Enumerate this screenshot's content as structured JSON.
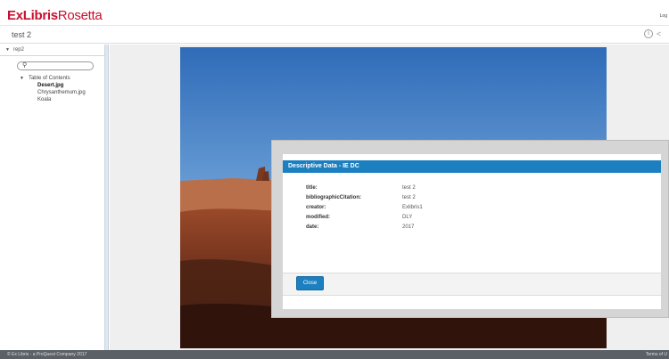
{
  "header": {
    "logo_ex": "ExLibris",
    "logo_rosetta": "Rosetta",
    "login_label": "Log"
  },
  "titlebar": {
    "title": "test 2",
    "info_icon": "info-icon",
    "share_icon": "share-icon"
  },
  "sidebar": {
    "rep_label": "rep2",
    "search": {
      "value": "",
      "placeholder": ""
    },
    "toc": {
      "heading": "Table of Contents",
      "items": [
        "Desert.jpg",
        "Chrysanthemum.jpg",
        "Koala"
      ],
      "active_index": 0
    }
  },
  "modal": {
    "title": "Descriptive Data - IE DC",
    "rows": [
      {
        "key": "title:",
        "value": "test 2"
      },
      {
        "key": "bibliographicCitation:",
        "value": "test 2"
      },
      {
        "key": "creator:",
        "value": "Exlibris1"
      },
      {
        "key": "modified:",
        "value": "DLY"
      },
      {
        "key": "date:",
        "value": "2017"
      }
    ],
    "close_label": "Close"
  },
  "footer": {
    "copyright": "© Ex Libris - a ProQuest Company 2017",
    "terms": "Terms of U"
  },
  "colors": {
    "brand_red": "#c8102e",
    "accent_blue": "#1b7fc0",
    "footer_bg": "#5b6066"
  }
}
